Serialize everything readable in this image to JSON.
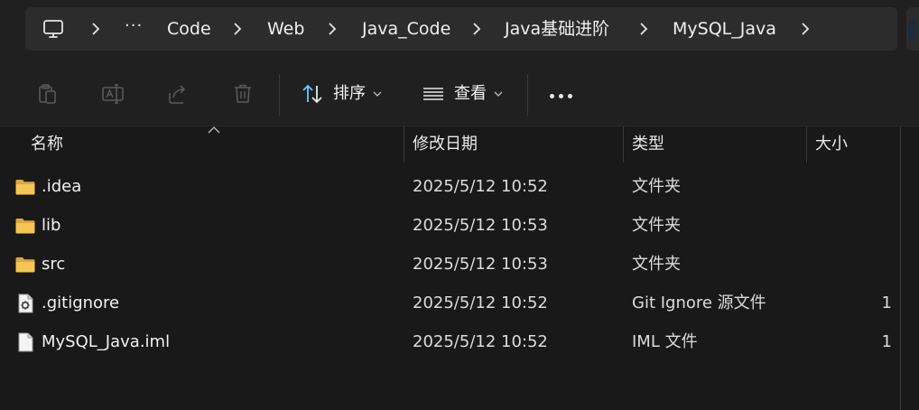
{
  "breadcrumb": {
    "more": "···",
    "items": [
      "Code",
      "Web",
      "Java_Code",
      "Java基础进阶",
      "MySQL_Java"
    ]
  },
  "toolbar": {
    "icons": [
      "paste-icon",
      "rename-icon",
      "share-icon",
      "delete-icon"
    ],
    "sort_label": "排序",
    "view_label": "查看"
  },
  "columns": {
    "name": "名称",
    "date": "修改日期",
    "type": "类型",
    "size": "大小"
  },
  "files": [
    {
      "name": ".idea",
      "date": "2025/5/12 10:52",
      "type": "文件夹",
      "size": "",
      "icon": "folder-icon"
    },
    {
      "name": "lib",
      "date": "2025/5/12 10:53",
      "type": "文件夹",
      "size": "",
      "icon": "folder-icon"
    },
    {
      "name": "src",
      "date": "2025/5/12 10:53",
      "type": "文件夹",
      "size": "",
      "icon": "folder-icon"
    },
    {
      "name": ".gitignore",
      "date": "2025/5/12 10:52",
      "type": "Git Ignore 源文件",
      "size": "1",
      "icon": "settings-file-icon"
    },
    {
      "name": "MySQL_Java.iml",
      "date": "2025/5/12 10:52",
      "type": "IML 文件",
      "size": "1",
      "icon": "file-icon"
    }
  ],
  "colors": {
    "background": "#191919",
    "toolbar": "#202020",
    "address_bar": "#2c2c2c",
    "folder": "#f2c14e",
    "accent": "#60cdff"
  }
}
